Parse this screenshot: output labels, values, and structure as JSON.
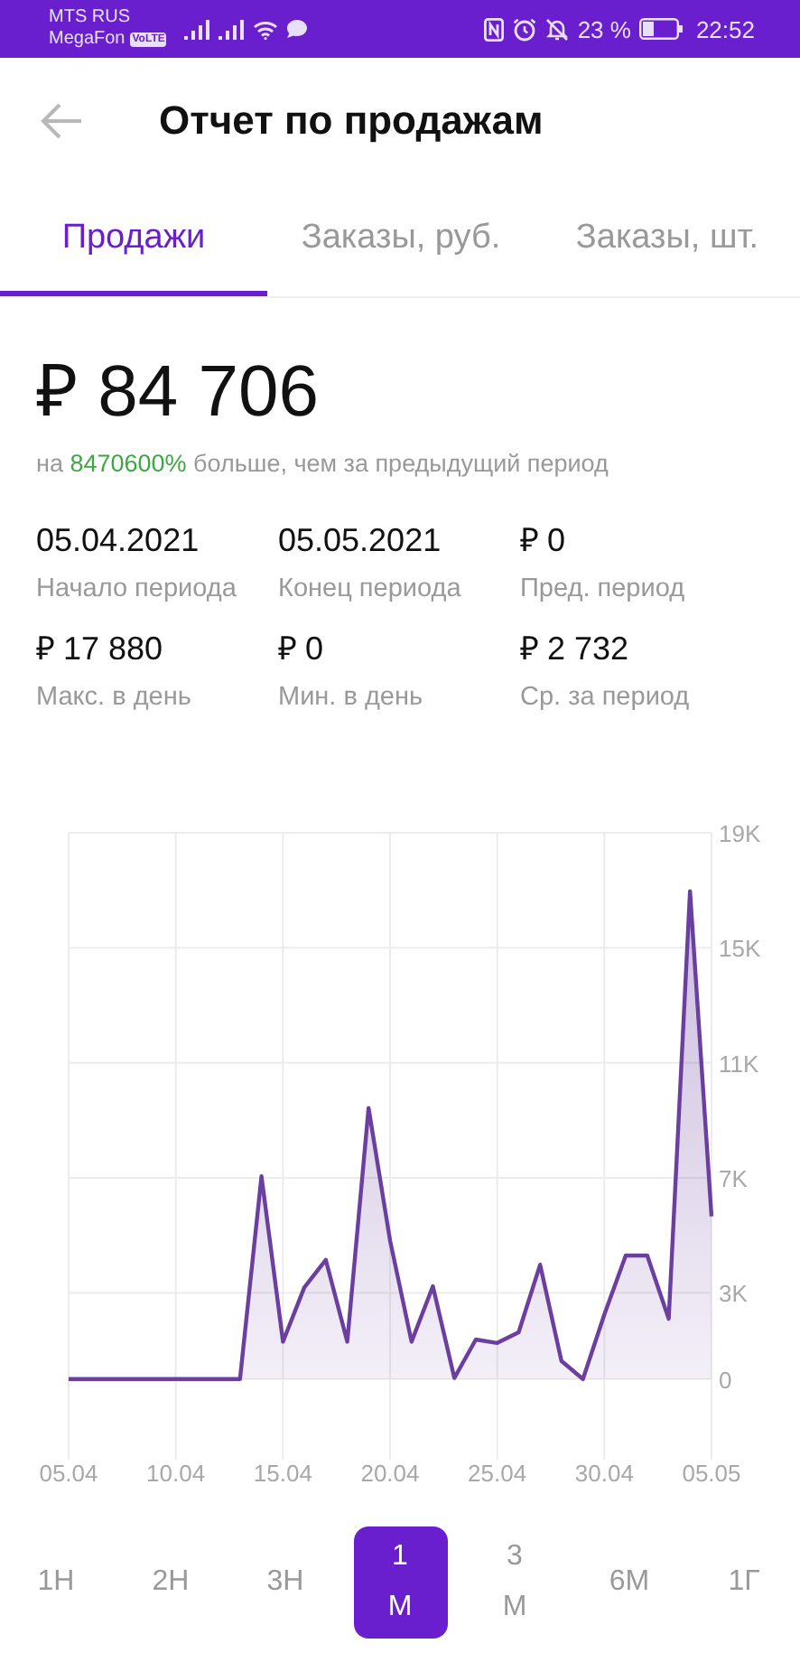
{
  "status_bar": {
    "carrier_1": "MTS RUS",
    "carrier_2": "MegaFon",
    "volte": "VoLTE",
    "battery": "23 %",
    "time": "22:52"
  },
  "header": {
    "title": "Отчет по продажам"
  },
  "tabs": [
    {
      "label": "Продажи",
      "selected": true
    },
    {
      "label": "Заказы, руб.",
      "selected": false
    },
    {
      "label": "Заказы, шт.",
      "selected": false
    }
  ],
  "summary": {
    "total": "₽ 84 706",
    "change": {
      "prefix": "на",
      "value": "8470600%",
      "suffix": "больше, чем за предыдущий период"
    }
  },
  "stats": [
    {
      "value": "05.04.2021",
      "label": "Начало периода"
    },
    {
      "value": "05.05.2021",
      "label": "Конец периода"
    },
    {
      "value": "₽ 0",
      "label": "Пред. период"
    },
    {
      "value": "₽ 17 880",
      "label": "Макс. в день"
    },
    {
      "value": "₽ 0",
      "label": "Мин. в день"
    },
    {
      "value": "₽ 2 732",
      "label": "Ср. за период"
    }
  ],
  "chart_data": {
    "type": "area",
    "grid": true,
    "categories": [
      "05.04",
      null,
      null,
      null,
      null,
      "10.04",
      null,
      null,
      null,
      null,
      "15.04",
      null,
      null,
      null,
      null,
      "20.04",
      null,
      null,
      null,
      null,
      "25.04",
      null,
      null,
      null,
      null,
      "30.04",
      null,
      null,
      null,
      null,
      "05.05"
    ],
    "series": [
      {
        "color": "#6b3fa0",
        "values": [
          0,
          0,
          0,
          0,
          0,
          0,
          0,
          0,
          0,
          7.06,
          1.3,
          3.19,
          4.15,
          1.3,
          9.43,
          4.82,
          1.3,
          3.23,
          0.04,
          1.38,
          1.26,
          1.63,
          3.98,
          0.63,
          0,
          2.26,
          4.3,
          4.3,
          2.1,
          16.97,
          5.66
        ]
      }
    ],
    "ylim": [
      -2.8,
      19
    ],
    "yticks": [
      {
        "value": 0,
        "label": "0"
      },
      {
        "value": 3,
        "label": "3K"
      },
      {
        "value": 7,
        "label": "7K"
      },
      {
        "value": 11,
        "label": "11K"
      },
      {
        "value": 15,
        "label": "15K"
      },
      {
        "value": 19,
        "label": "19K"
      }
    ]
  },
  "periods": [
    {
      "label": "1Н",
      "selected": false
    },
    {
      "label": "2Н",
      "selected": false
    },
    {
      "label": "3Н",
      "selected": false
    },
    {
      "label": "1 М",
      "selected": true
    },
    {
      "label": "3 М",
      "selected": false
    },
    {
      "label": "6М",
      "selected": false
    },
    {
      "label": "1Г",
      "selected": false
    }
  ]
}
